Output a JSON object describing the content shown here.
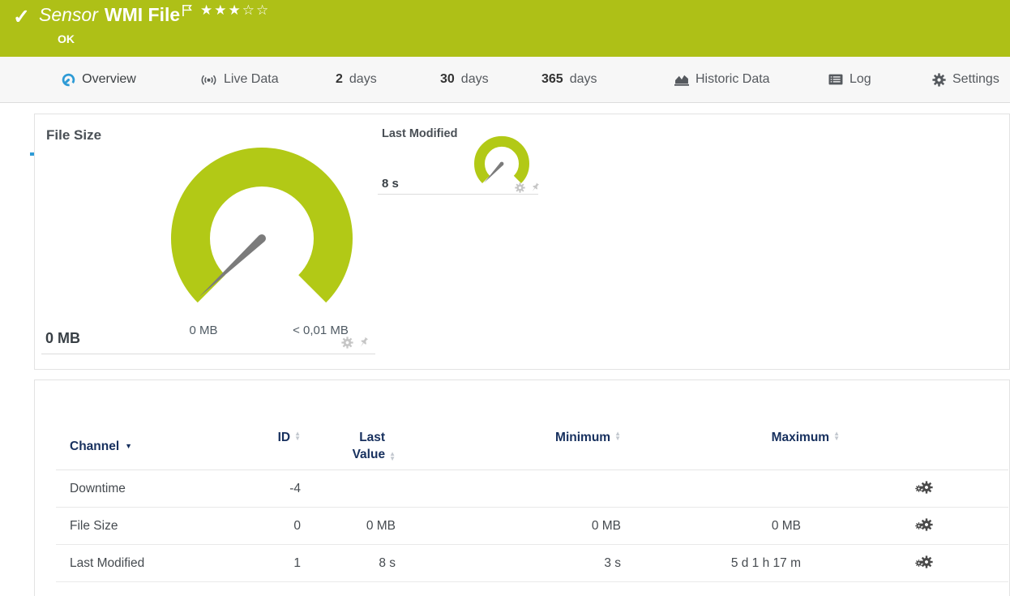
{
  "colors": {
    "header-green": "#aec017",
    "gauge-green": "#b2c916",
    "accent-blue": "#2e9bd6",
    "navy": "#17305e"
  },
  "header": {
    "check_glyph": "✓",
    "sensor_label": "Sensor",
    "title": "WMI File",
    "status": "OK",
    "rating_stars": "★★★☆☆"
  },
  "tabs": {
    "overview": {
      "label": "Overview"
    },
    "live_data": {
      "label": "Live Data"
    },
    "days2": {
      "num": "2",
      "label": "days"
    },
    "days30": {
      "num": "30",
      "label": "days"
    },
    "days365": {
      "num": "365",
      "label": "days"
    },
    "historic": {
      "label": "Historic Data"
    },
    "log": {
      "label": "Log"
    },
    "settings": {
      "label": "Settings"
    }
  },
  "gauges": {
    "file_size": {
      "title": "File Size",
      "value": "0 MB",
      "scale_min": "0 MB",
      "scale_max": "< 0,01 MB"
    },
    "last_modified": {
      "title": "Last Modified",
      "value": "8 s"
    }
  },
  "table": {
    "headers": {
      "channel": "Channel",
      "id": "ID",
      "last_value": "Last Value",
      "minimum": "Minimum",
      "maximum": "Maximum"
    },
    "rows": [
      {
        "channel": "Downtime",
        "id": "-4",
        "last_value": "",
        "minimum": "",
        "maximum": ""
      },
      {
        "channel": "File Size",
        "id": "0",
        "last_value": "0 MB",
        "minimum": "0 MB",
        "maximum": "0 MB"
      },
      {
        "channel": "Last Modified",
        "id": "1",
        "last_value": "8 s",
        "minimum": "3 s",
        "maximum": "5 d 1 h 17 m"
      }
    ]
  },
  "icons": {
    "sort_up": "▲",
    "sort_down": "▼",
    "sorted_desc": "▼"
  }
}
